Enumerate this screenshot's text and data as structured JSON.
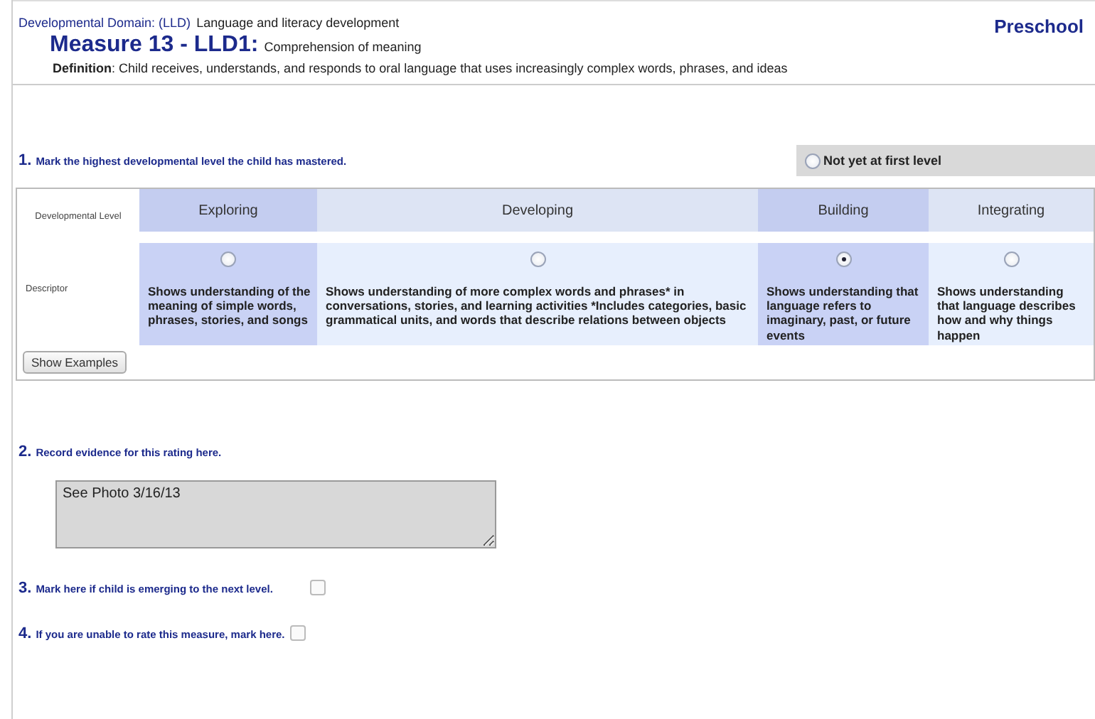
{
  "header": {
    "domain_label": "Developmental Domain: (LLD)",
    "domain": "Language and literacy development",
    "measure": "Measure 13 - LLD1:",
    "measure_title": "Comprehension of meaning",
    "program": "Preschool",
    "definition_label": "Definition",
    "definition": ": Child receives, understands, and responds to oral language that uses increasingly complex words, phrases, and ideas"
  },
  "question_1": {
    "number": "1.",
    "text": "Mark the highest developmental level the child has mastered.",
    "not_yet": {
      "label": "Not yet at first level",
      "selected": false
    }
  },
  "levels_table": {
    "row_label": "Developmental Level",
    "descriptor_label": "Descriptor",
    "levels": [
      {
        "name": "Exploring",
        "highlighted": true,
        "selected": false,
        "descriptor": "Shows understanding of the meaning of simple words, phrases, stories, and songs"
      },
      {
        "name": "Developing",
        "highlighted": false,
        "selected": false,
        "descriptor": "Shows understanding of more complex words and phrases* in conversations, stories, and learning activities *Includes categories, basic grammatical units, and words that describe relations between objects"
      },
      {
        "name": "Building",
        "highlighted": true,
        "selected": true,
        "descriptor": "Shows understanding that language refers to imaginary, past, or future events"
      },
      {
        "name": "Integrating",
        "highlighted": false,
        "selected": false,
        "descriptor": "Shows understanding that language describes how and why things happen"
      }
    ],
    "button": "Show Examples"
  },
  "question_2": {
    "number": "2.",
    "text": "Record evidence for this rating here.",
    "evidence": "See Photo 3/16/13"
  },
  "question_3": {
    "number": "3.",
    "text": "Mark here if child is emerging to the next level.",
    "checked": false
  },
  "question_4": {
    "number": "4.",
    "text": "If you are unable to rate this measure, mark here.",
    "checked": false
  }
}
